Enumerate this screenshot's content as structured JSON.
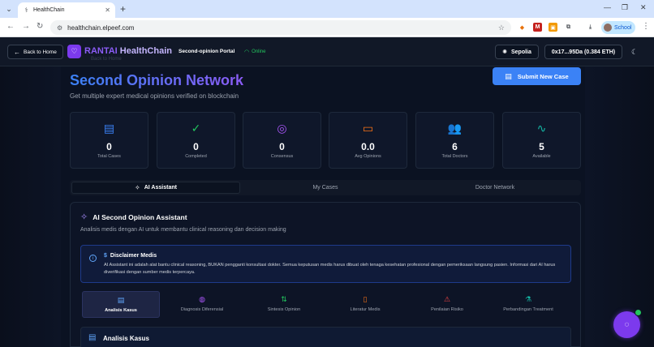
{
  "browser": {
    "tab_title": "HealthChain",
    "url": "healthchain.elpeef.com",
    "profile_label": "School"
  },
  "header": {
    "back_label": "Back to Home",
    "brand_part1": "RANTAI",
    "brand_part2": "HealthChain",
    "ghost_text": "Back to Home",
    "portal_label": "Second-opinion Portal",
    "status_label": "Online",
    "network_label": "Sepolia",
    "wallet_label": "0x17...95Da (0.384 ETH)"
  },
  "hero": {
    "title": "Second Opinion Network",
    "subtitle": "Get multiple expert medical opinions verified on blockchain",
    "submit_label": "Submit New Case"
  },
  "stats": [
    {
      "value": "0",
      "label": "Total Cases",
      "icon": "document-icon",
      "color": "#3b82f6"
    },
    {
      "value": "0",
      "label": "Completed",
      "icon": "check-circle-icon",
      "color": "#22c55e"
    },
    {
      "value": "0",
      "label": "Consensus",
      "icon": "target-icon",
      "color": "#a855f7"
    },
    {
      "value": "0.0",
      "label": "Avg Opinions",
      "icon": "message-icon",
      "color": "#f97316"
    },
    {
      "value": "6",
      "label": "Total Doctors",
      "icon": "users-icon",
      "color": "#3b82f6"
    },
    {
      "value": "5",
      "label": "Available",
      "icon": "activity-icon",
      "color": "#14b8a6"
    }
  ],
  "tabs": [
    {
      "label": "AI Assistant",
      "active": true
    },
    {
      "label": "My Cases",
      "active": false
    },
    {
      "label": "Doctor Network",
      "active": false
    }
  ],
  "panel": {
    "title": "AI Second Opinion Assistant",
    "subtitle": "Analisis medis dengan AI untuk membantu clinical reasoning dan decision making",
    "disclaimer_title": "Disclaimer Medis",
    "disclaimer_body": "AI Assistant ini adalah alat bantu clinical reasoning, BUKAN pengganti konsultasi dokter. Semua keputusan medis harus dibuat oleh tenaga kesehatan profesional dengan pemeriksaan langsung pasien. Informasi dari AI harus diverifikasi dengan sumber medis terpercaya.",
    "features": [
      {
        "label": "Analisis Kasus",
        "icon": "file-text-icon",
        "color": "#60a5fa",
        "active": true
      },
      {
        "label": "Diagnosis Diferensial",
        "icon": "brain-icon",
        "color": "#a855f7",
        "active": false
      },
      {
        "label": "Sintesis Opinion",
        "icon": "merge-icon",
        "color": "#22c55e",
        "active": false
      },
      {
        "label": "Literatur Medis",
        "icon": "book-icon",
        "color": "#f97316",
        "active": false
      },
      {
        "label": "Penilaian Risiko",
        "icon": "alert-triangle-icon",
        "color": "#ef4444",
        "active": false
      },
      {
        "label": "Perbandingan Treatment",
        "icon": "flask-icon",
        "color": "#14b8a6",
        "active": false
      }
    ],
    "section_title": "Analisis Kasus"
  }
}
